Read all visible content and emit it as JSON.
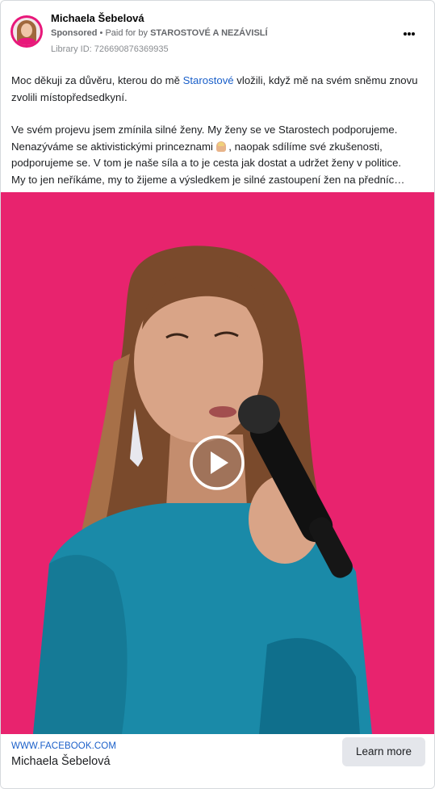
{
  "ad": {
    "page_name": "Michaela Šebelová",
    "sponsored_label": "Sponsored",
    "paid_for_prefix": "Paid for by",
    "funder": "STAROSTOVÉ A NEZÁVISLÍ",
    "library_id": "Library ID: 726690876369935"
  },
  "post": {
    "p1_before_link": "Moc děkuji za důvěru, kterou do mě ",
    "p1_link": "Starostové",
    "p1_after_link": " vložili, když mě na svém sněmu znovu zvolili místopředsedkyní.",
    "p2_before_emoji": "Ve svém projevu jsem zmínila silné ženy. My ženy se ve Starostech podporujeme. Nenazýváme se aktivistickými princeznami ",
    "p2_after_emoji": " , naopak sdílíme své zkušenosti, podporujeme se. V tom je naše síla a to je cesta jak dostat a udržet ženy v politice.",
    "p3": "My to jen neříkáme, my to žijeme a výsledkem je silné zastoupení žen na předníc…"
  },
  "footer": {
    "url": "WWW.FACEBOOK.COM",
    "title": "Michaela Šebelová",
    "cta_label": "Learn more"
  },
  "icons": {
    "avatar": "profile-photo",
    "more": "more-options-icon",
    "emoji": "woman-gesturing-no-emoji",
    "play": "play-icon"
  },
  "colors": {
    "link": "#1a5fc9",
    "video_background": "#e8236e",
    "dress": "#1a8aa8",
    "cta_background": "#e4e6eb"
  }
}
